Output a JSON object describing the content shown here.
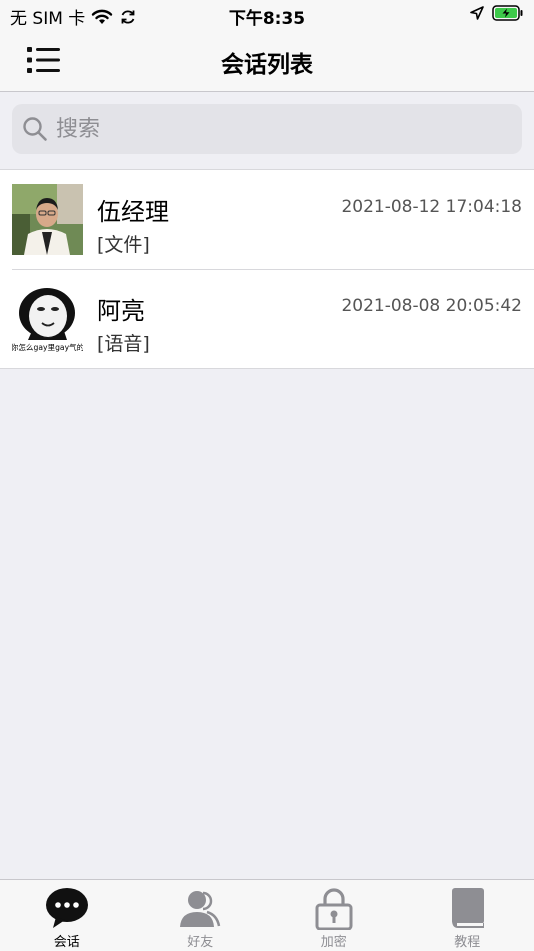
{
  "status_bar": {
    "carrier": "无 SIM 卡",
    "time": "下午8:35"
  },
  "nav": {
    "title": "会话列表",
    "menu_icon": "list-menu-icon"
  },
  "search": {
    "placeholder": "搜索",
    "value": ""
  },
  "conversations": [
    {
      "name": "伍经理",
      "preview": "[文件]",
      "time": "2021-08-12 17:04:18"
    },
    {
      "name": "阿亮",
      "preview": "[语音]",
      "time": "2021-08-08 20:05:42",
      "avatar_caption": "你怎么gay里gay气的"
    }
  ],
  "tabs": [
    {
      "label": "会话",
      "icon": "chat-bubble-icon",
      "active": true
    },
    {
      "label": "好友",
      "icon": "friends-icon",
      "active": false
    },
    {
      "label": "加密",
      "icon": "lock-icon",
      "active": false
    },
    {
      "label": "教程",
      "icon": "book-icon",
      "active": false
    }
  ],
  "colors": {
    "battery_green": "#3dc94a",
    "icon_gray": "#8e8e93"
  }
}
